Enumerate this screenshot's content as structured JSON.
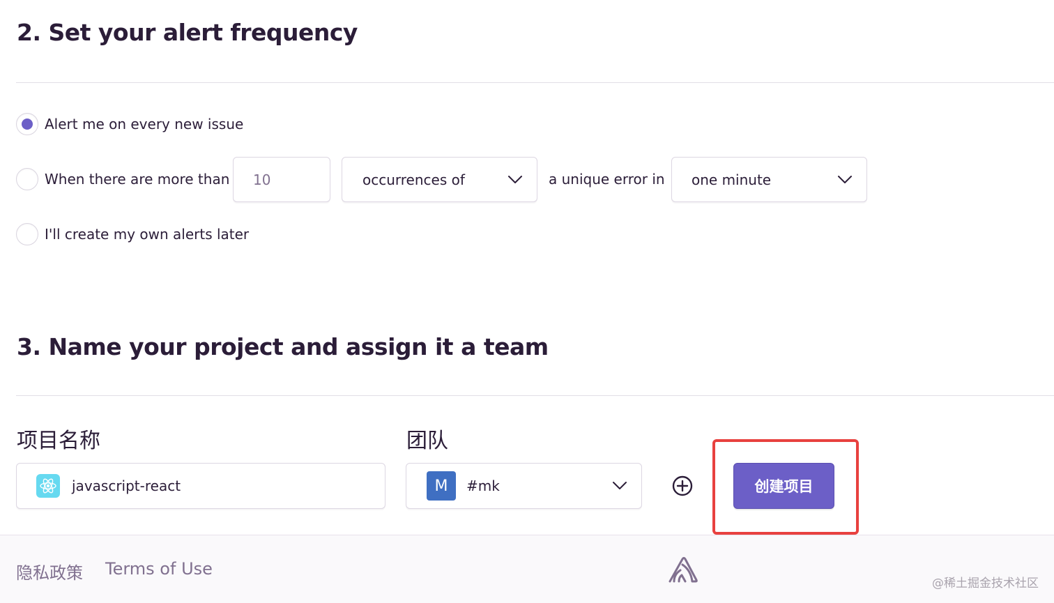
{
  "alert_section": {
    "title": "2. Set your alert frequency",
    "options": {
      "every_new_issue": {
        "label": "Alert me on every new issue",
        "checked": true
      },
      "threshold": {
        "label": "When there are more than",
        "checked": false
      },
      "later": {
        "label": "I'll create my own alerts later",
        "checked": false
      }
    },
    "threshold_value_placeholder": "10",
    "metric_select": "occurrences of",
    "connector_text": "a unique error in",
    "interval_select": "one minute"
  },
  "project_section": {
    "title": "3. Name your project and assign it a team",
    "project_name_label": "项目名称",
    "project_name_value": "javascript-react",
    "project_icon": "react-icon",
    "team_label": "团队",
    "team_avatar_letter": "M",
    "team_value": "#mk",
    "add_team_icon": "add-circle-icon",
    "create_button_label": "创建项目"
  },
  "footer": {
    "privacy_link": "隐私政策",
    "terms_link": "Terms of Use",
    "logo_icon": "sentry-logo-icon",
    "watermark": "@稀土掘金技术社区"
  },
  "colors": {
    "accent": "#6c5fc7",
    "highlight_border": "#e8413f",
    "team_avatar": "#3f6fc2",
    "react_icon_bg": "#66d9f0"
  }
}
